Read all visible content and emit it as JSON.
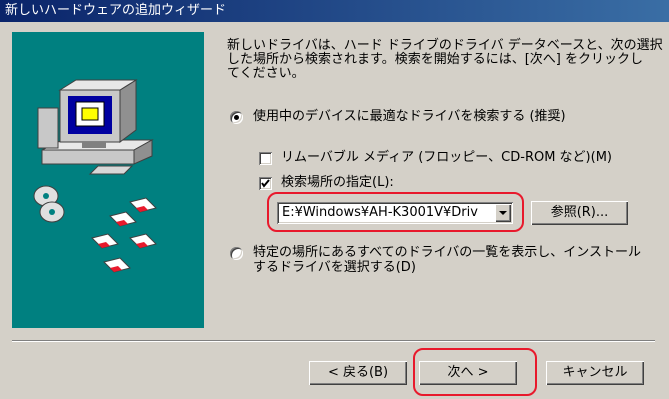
{
  "window": {
    "title": "新しいハードウェアの追加ウィザード"
  },
  "description_lines": [
    "新しいドライバは、ハード ドライブのドライバ データベースと、次の選択",
    "した場所から検索されます。検索を開始するには、[次へ] をクリックし",
    "てください。"
  ],
  "options": {
    "search_best": {
      "label": "使用中のデバイスに最適なドライバを検索する (推奨)",
      "selected": true
    },
    "removable": {
      "label": "リムーバブル メディア (フロッピー、CD-ROM など)(M)",
      "checked": false
    },
    "specify_location": {
      "label": "検索場所の指定(L):",
      "checked": true
    },
    "location_value": "E:¥Windows¥AH-K3001V¥Driv",
    "browse_label": "参照(R)...",
    "list_all": {
      "label_lines": [
        "特定の場所にあるすべてのドライバの一覧を表示し、インストール",
        "するドライバを選択する(D)"
      ],
      "selected": false
    }
  },
  "buttons": {
    "back": "< 戻る(B)",
    "next": "次へ >",
    "cancel": "キャンセル"
  },
  "colors": {
    "panel": "#008080",
    "titlebar": "#0a246a",
    "highlight": "#e8192c"
  },
  "icons": [
    "computer-icon",
    "cd-disc-icon",
    "floppy-disk-icon"
  ]
}
